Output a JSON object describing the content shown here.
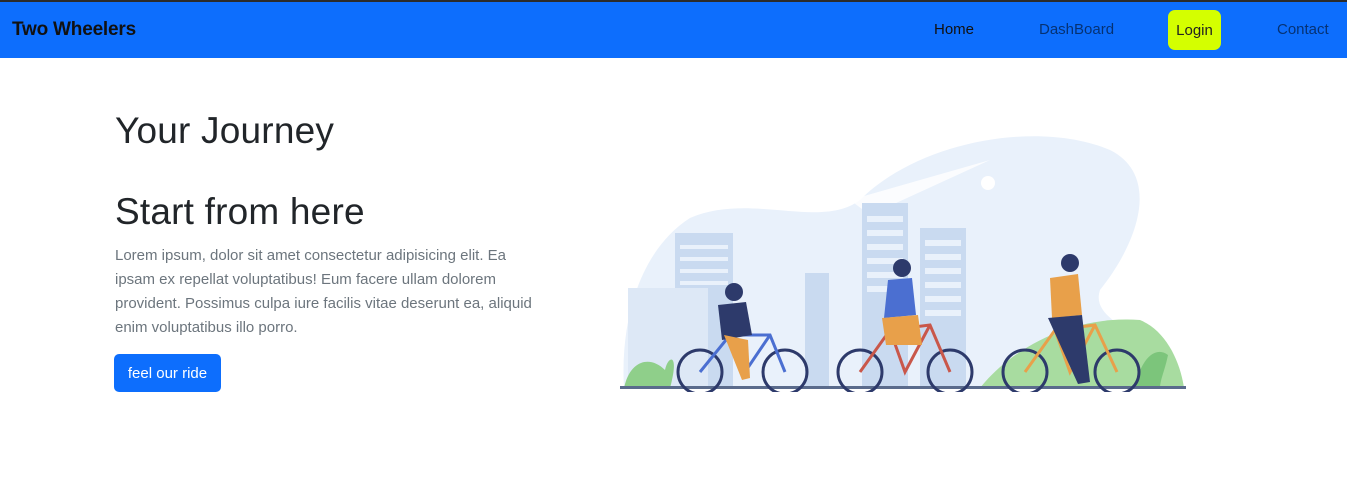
{
  "navbar": {
    "brand": "Two Wheelers",
    "links": {
      "home": "Home",
      "dashboard": "DashBoard",
      "login": "Login",
      "contact": "Contact"
    },
    "colors": {
      "background": "#0d6efd",
      "login_highlight": "#d4ff00"
    }
  },
  "hero": {
    "title_line_1": "Your Journey",
    "title_line_2": "Start from here",
    "paragraph": "Lorem ipsum, dolor sit amet consectetur adipisicing elit. Ea ipsam ex repellat voluptatibus! Eum facere ullam dolorem provident. Possimus culpa iure facilis vitae deserunt ea, aliquid enim voluptatibus illo porro.",
    "cta_label": "feel our ride"
  },
  "illustration": {
    "subject": "three-cyclists-city-illustration"
  }
}
